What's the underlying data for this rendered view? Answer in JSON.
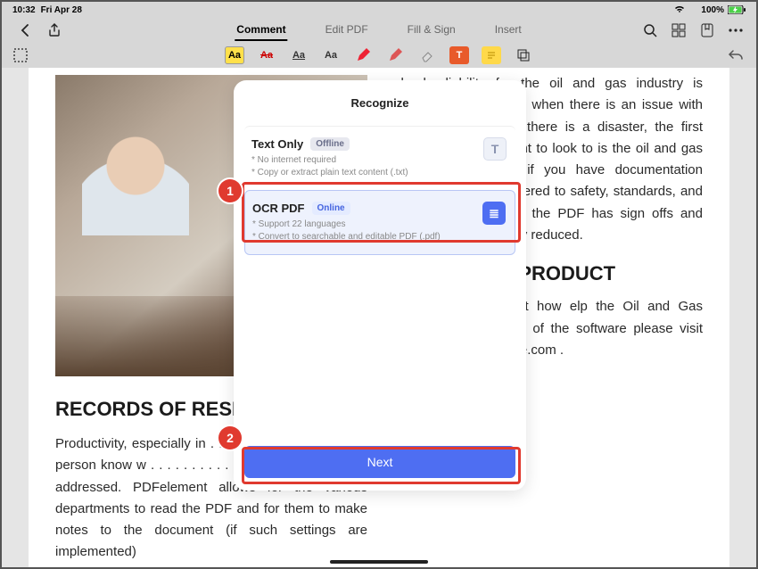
{
  "status": {
    "time": "10:32",
    "date": "Fri Apr 28",
    "battery": "100%"
  },
  "tabs": {
    "comment": "Comment",
    "edit": "Edit PDF",
    "fill": "Fill & Sign",
    "insert": "Insert"
  },
  "tool_labels": {
    "aa": "Aa",
    "t": "T"
  },
  "doc": {
    "col_right_top": "clearly, liability for the oil and gas industry is decreased. Generally, when there is an issue with operations, or when there is a disaster, the first place that people want to look to is the oil and gas company. However, if you have documentation showing that you adhered to safety, standards, and to regulations, and if the PDF has sign offs and such, liability is greatly reduced.",
    "heading_left": "RECORDS OF RESPON",
    "body_left": "Productivity, especially in  . . . . . . . . . . . .  that each person know w . . . . . . . . . . . .  to whom the task is addressed. PDFelement allows for the various departments to read the PDF and for them to make notes to the document (if such settings are implemented)",
    "heading_right": "ABOUT OUR PRODUCT",
    "body_right": "To know more about how  elp the Oil and Gas industry,  to try a trial of the software please visit http://pdf.wondershare.com ."
  },
  "modal": {
    "title": "Recognize",
    "option1": {
      "title": "Text Only",
      "badge": "Offline",
      "line1": "* No internet required",
      "line2": "* Copy or extract plain text content (.txt)",
      "icon": "T"
    },
    "option2": {
      "title": "OCR PDF",
      "badge": "Online",
      "line1": "* Support 22 languages",
      "line2": "* Convert to searchable and editable PDF (.pdf)",
      "icon": "≣"
    },
    "next": "Next"
  },
  "annot": {
    "n1": "1",
    "n2": "2"
  }
}
